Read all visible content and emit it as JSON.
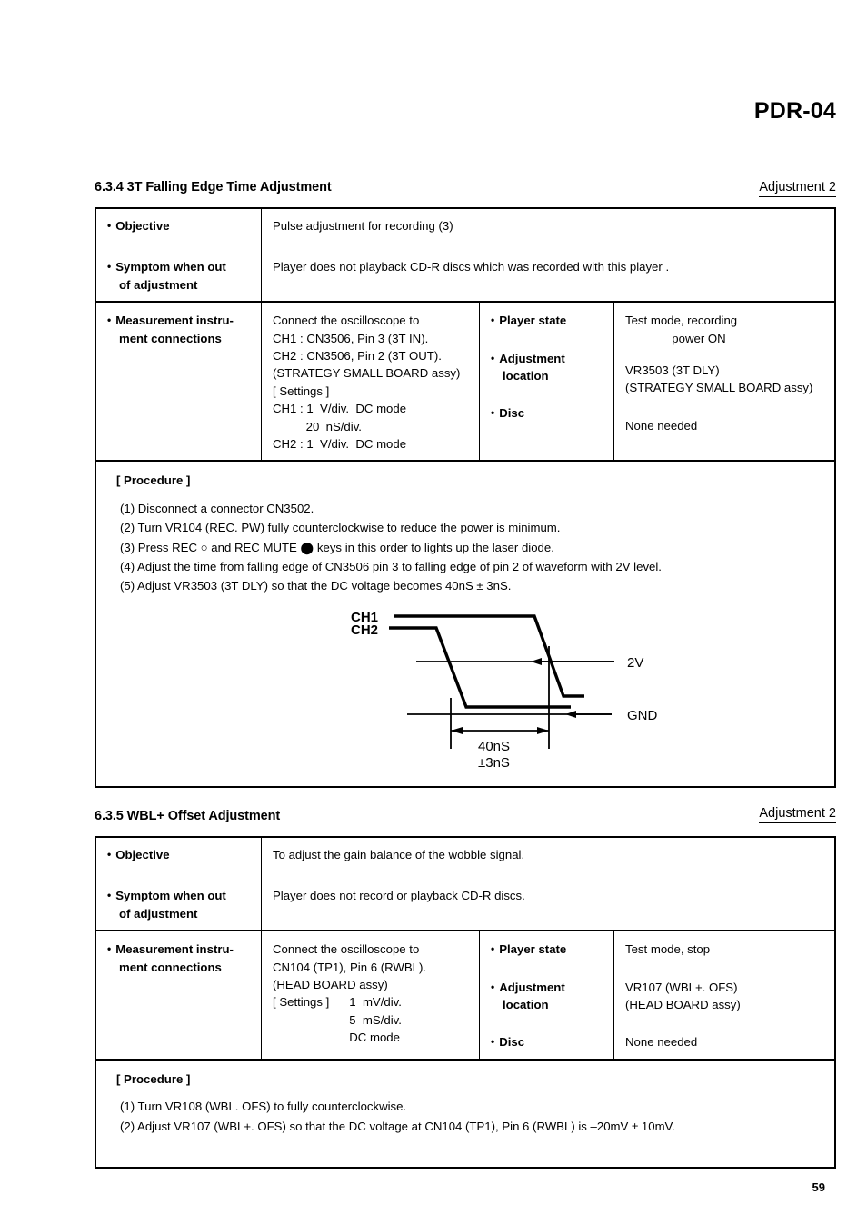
{
  "header": {
    "model": "PDR-04"
  },
  "page_number": "59",
  "sections": [
    {
      "heading": "6.3.4 3T Falling Edge Time Adjustment",
      "adjustment_tag": "Adjustment 2",
      "objective_label": "Objective",
      "objective_text": "Pulse adjustment for recording (3)",
      "symptom_label_line1": "Symptom when out",
      "symptom_label_line2": "of adjustment",
      "symptom_text": "Player does not playback CD-R discs which was recorded with this player .",
      "measurement_label_line1": "Measurement instru-",
      "measurement_label_line2": "ment  connections",
      "measurement_lines": [
        "Connect the oscilloscope to",
        "CH1 : CN3506, Pin 3 (3T IN).",
        "CH2 : CN3506, Pin 2 (3T OUT).",
        "(STRATEGY SMALL BOARD assy)",
        "[ Settings ]",
        "CH1 : 1  V/div.  DC mode",
        "          20  nS/div.",
        "CH2 : 1  V/div.  DC mode"
      ],
      "player_state_label": "Player state",
      "player_state_value_line1": "Test mode, recording",
      "player_state_value_line2": "              power ON",
      "adjustment_location_label_line1": "Adjustment",
      "adjustment_location_label_line2": "location",
      "adjustment_location_value_line1": "VR3503 (3T DLY)",
      "adjustment_location_value_line2": "(STRATEGY SMALL BOARD assy)",
      "disc_label": "Disc",
      "disc_value": "None needed",
      "procedure_title": "[ Procedure ]",
      "procedure_items": [
        "(1) Disconnect a connector CN3502.",
        "(2) Turn VR104 (REC. PW) fully counterclockwise to reduce the power is minimum.",
        "(3) Press REC ○ and REC MUTE ⬤ keys in this order to lights up the laser diode.",
        "(4) Adjust the time from falling edge of CN3506 pin 3 to falling edge of pin 2 of waveform with 2V level.",
        "(5) Adjust VR3503 (3T DLY) so that the DC voltage becomes 40nS ± 3nS."
      ],
      "figure": {
        "ch1_label": "CH1",
        "ch2_label": "CH2",
        "level_label": "2V",
        "ground_label": "GND",
        "dimension_value": "40nS",
        "dimension_tolerance": "±3nS"
      }
    },
    {
      "heading": "6.3.5 WBL+ Offset Adjustment",
      "adjustment_tag": "Adjustment 2",
      "objective_label": "Objective",
      "objective_text": "To adjust the gain balance of the wobble signal.",
      "symptom_label_line1": "Symptom when out",
      "symptom_label_line2": "of adjustment",
      "symptom_text": "Player does not record or playback CD-R discs.",
      "measurement_label_line1": "Measurement instru-",
      "measurement_label_line2": "ment  connections",
      "measurement_lines": [
        "Connect the oscilloscope to",
        "CN104 (TP1), Pin 6 (RWBL).",
        "(HEAD BOARD assy)",
        "[ Settings ]      1  mV/div.",
        "                       5  mS/div.",
        "                       DC mode"
      ],
      "player_state_label": "Player state",
      "player_state_value_line1": "Test mode, stop",
      "player_state_value_line2": "",
      "adjustment_location_label_line1": "Adjustment",
      "adjustment_location_label_line2": "location",
      "adjustment_location_value_line1": "VR107 (WBL+. OFS)",
      "adjustment_location_value_line2": "(HEAD BOARD assy)",
      "disc_label": "Disc",
      "disc_value": "None needed",
      "procedure_title": "[ Procedure ]",
      "procedure_items": [
        "(1) Turn VR108 (WBL. OFS)  to fully counterclockwise.",
        "(2) Adjust VR107 (WBL+. OFS) so that the DC voltage at CN104 (TP1), Pin 6 (RWBL) is –20mV ± 10mV."
      ]
    }
  ]
}
